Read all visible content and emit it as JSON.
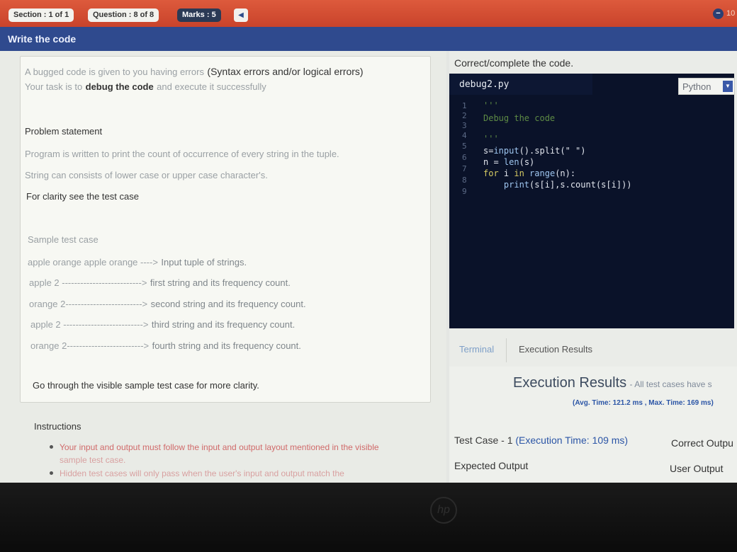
{
  "header": {
    "section": "Section : 1 of 1",
    "question": "Question : 8 of 8",
    "marks": "Marks : 5",
    "timer": "10"
  },
  "subheader": {
    "title": "Write the code"
  },
  "question": {
    "intro_line1_a": "A bugged code is given to you having errors",
    "intro_line1_b": "(Syntax errors and/or logical errors)",
    "intro_line2_a": "Your task is to",
    "intro_line2_b": "debug the code",
    "intro_line2_c": "and execute it successfully",
    "problem_heading": "Problem statement",
    "problem_line1": "Program is written to print the count of occurrence of every string in the tuple.",
    "problem_line2": "String can consists of lower case or upper case character's.",
    "clarity": "For clarity see the test case",
    "sample_heading": "Sample test case",
    "sample_rows": [
      {
        "left": "apple orange apple orange ---->",
        "right": "Input tuple of strings."
      },
      {
        "left": "apple 2 -------------------------->",
        "right": "first string and its frequency count."
      },
      {
        "left": "orange 2------------------------->",
        "right": "second string and its frequency count."
      },
      {
        "left": "apple 2 -------------------------->",
        "right": "third string and its frequency count."
      },
      {
        "left": "orange 2------------------------->",
        "right": "fourth string and its frequency count."
      }
    ],
    "go_through": "Go through the visible sample test case for more clarity.",
    "instructions_heading": "Instructions",
    "instruction_1a": "Your input and output must follow the input and output layout mentioned in the visible",
    "instruction_1b": "sample test case.",
    "instruction_2": "Hidden test cases will only pass when the user's input and output match the"
  },
  "editor": {
    "heading": "Correct/complete the code.",
    "filename": "debug2.py",
    "language": "Python",
    "line_numbers": [
      "1",
      "2",
      "3",
      "4",
      "5",
      "6",
      "7",
      "8",
      "9"
    ],
    "code": {
      "l1": "'''",
      "l2": "Debug the code",
      "l4": "'''",
      "l5_a": "s=",
      "l5_b": "input",
      "l5_c": "().split(\" \")",
      "l6_a": "n = ",
      "l6_b": "len",
      "l6_c": "(s)",
      "l7_a": "for",
      "l7_b": " i ",
      "l7_c": "in",
      "l7_d": " range",
      "l7_e": "(n):",
      "l8_a": "    print",
      "l8_b": "(s[i],s.count(s[i]))"
    }
  },
  "tabs": {
    "terminal": "Terminal",
    "execution": "Execution Results"
  },
  "results": {
    "title": "Execution Results",
    "title_suffix": "- All test cases have s",
    "timing": "(Avg. Time: 121.2 ms , Max. Time: 169 ms)",
    "testcase_a": "Test Case - 1",
    "testcase_b": "(Execution Time: 109 ms)",
    "correct_output": "Correct Outpu",
    "expected_output": "Expected Output",
    "user_output": "User Output"
  },
  "colors": {
    "topbar": "#c9432b",
    "subbar": "#2f4a8e",
    "editor_bg": "#0a1229",
    "accent_blue": "#2b55a6"
  }
}
